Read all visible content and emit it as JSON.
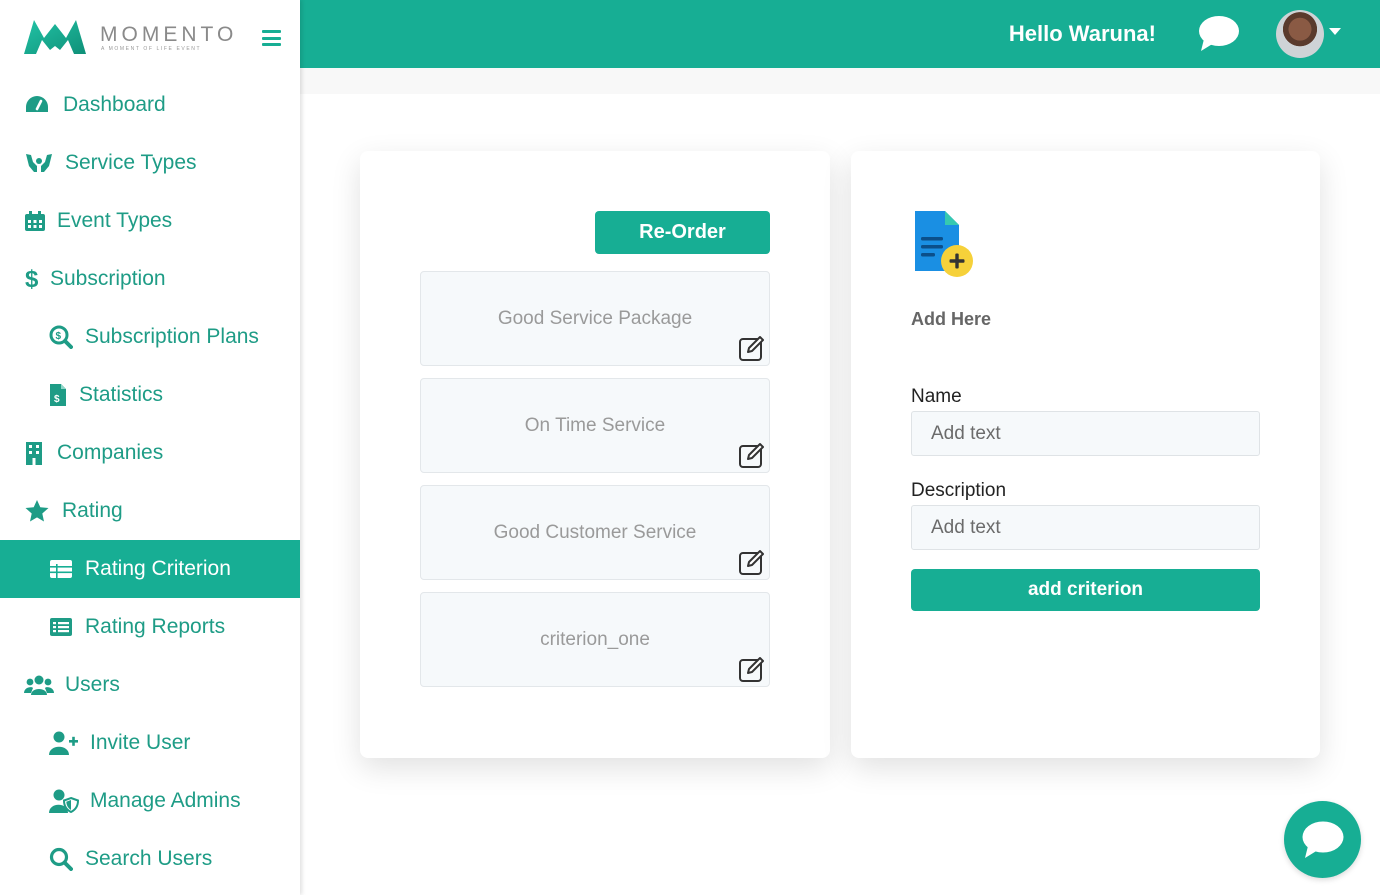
{
  "brand": {
    "name": "MOMENTO",
    "tagline": "A MOMENT OF LIFE EVENT"
  },
  "colors": {
    "accent": "#17ae94",
    "muted_text": "#9a9a9a"
  },
  "header": {
    "greeting": "Hello Waruna!"
  },
  "sidebar": {
    "items": [
      {
        "label": "Dashboard",
        "icon": "dashboard-gauge-icon",
        "level": 0,
        "active": false
      },
      {
        "label": "Service Types",
        "icon": "hands-icon",
        "level": 0,
        "active": false
      },
      {
        "label": "Event Types",
        "icon": "calendar-icon",
        "level": 0,
        "active": false
      },
      {
        "label": "Subscription",
        "icon": "dollar-icon",
        "level": 0,
        "active": false
      },
      {
        "label": "Subscription Plans",
        "icon": "search-dollar-icon",
        "level": 1,
        "active": false
      },
      {
        "label": "Statistics",
        "icon": "invoice-dollar-icon",
        "level": 1,
        "active": false
      },
      {
        "label": "Companies",
        "icon": "building-icon",
        "level": 0,
        "active": false
      },
      {
        "label": "Rating",
        "icon": "star-icon",
        "level": 0,
        "active": false
      },
      {
        "label": "Rating Criterion",
        "icon": "table-icon",
        "level": 1,
        "active": true
      },
      {
        "label": "Rating Reports",
        "icon": "list-alt-icon",
        "level": 1,
        "active": false
      },
      {
        "label": "Users",
        "icon": "users-icon",
        "level": 0,
        "active": false
      },
      {
        "label": "Invite User",
        "icon": "user-plus-icon",
        "level": 1,
        "active": false
      },
      {
        "label": "Manage Admins",
        "icon": "user-shield-icon",
        "level": 1,
        "active": false
      },
      {
        "label": "Search Users",
        "icon": "search-icon",
        "level": 1,
        "active": false
      }
    ]
  },
  "criteria_panel": {
    "reorder_label": "Re-Order",
    "items": [
      "Good Service Package",
      "On Time Service",
      "Good Customer Service",
      "criterion_one"
    ]
  },
  "form_panel": {
    "title": "Add Here",
    "name_label": "Name",
    "name_placeholder": "Add text",
    "description_label": "Description",
    "description_placeholder": "Add text",
    "submit_label": "add criterion"
  }
}
